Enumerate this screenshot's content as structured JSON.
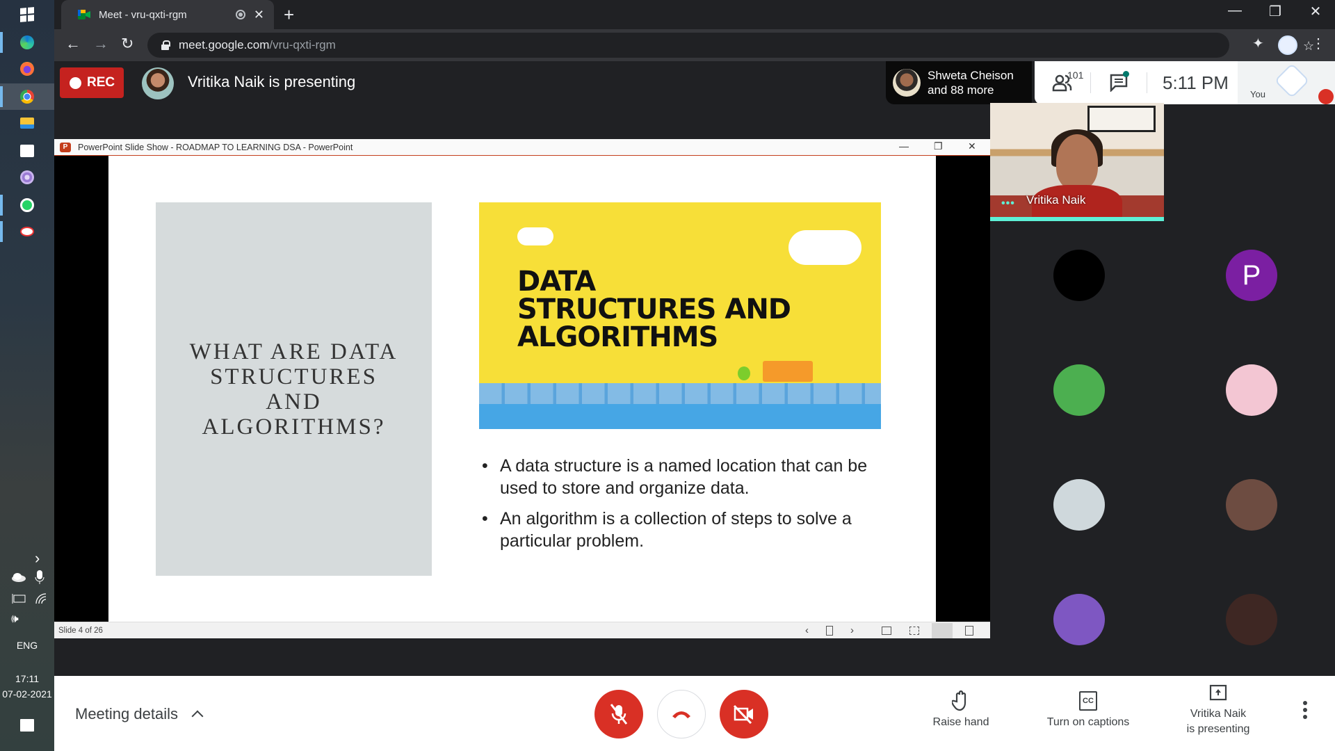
{
  "taskbar": {
    "apps": [
      {
        "name": "windows-start",
        "active": false
      },
      {
        "name": "edge",
        "active": false,
        "running": true
      },
      {
        "name": "firefox",
        "active": false
      },
      {
        "name": "chrome",
        "active": true,
        "running": true
      },
      {
        "name": "file-explorer",
        "active": false
      },
      {
        "name": "microsoft-store",
        "active": false
      },
      {
        "name": "tor-browser",
        "active": false
      },
      {
        "name": "whatsapp",
        "active": false,
        "running": true
      },
      {
        "name": "snipping-tool",
        "active": false,
        "running": true
      }
    ],
    "tray": {
      "language": "ENG",
      "time": "17:11",
      "date": "07-02-2021",
      "expand_glyph": "›",
      "volume_glyph": "🕪"
    }
  },
  "browser": {
    "tab_title": "Meet - vru-qxti-rgm",
    "new_tab_glyph": "+",
    "close_glyph": "✕",
    "url_host": "meet.google.com",
    "url_path": "/vru-qxti-rgm",
    "window_controls": {
      "minimize": "—",
      "maximize": "❐",
      "close": "✕"
    },
    "nav": {
      "back": "←",
      "forward": "→",
      "reload": "↻"
    },
    "toolbar_icons": {
      "camera": "■",
      "star": "☆",
      "extensions": "✦",
      "menu": "⋮"
    }
  },
  "meet": {
    "rec_label": "REC",
    "presenting_banner": "Vritika Naik is presenting",
    "who_is_here": {
      "line1": "Shweta Cheison",
      "line2": "and 88 more"
    },
    "participant_count": "101",
    "clock": "5:11  PM",
    "self_label": "You",
    "featured": {
      "name": "Vritika Naik",
      "dots": "•••"
    },
    "tiles": [
      {
        "initial": "",
        "color": "#000000"
      },
      {
        "initial": "P",
        "color": "#7b1fa2"
      },
      {
        "initial": "",
        "color": "#4caf50"
      },
      {
        "initial": "",
        "color": "#f3c6d3"
      },
      {
        "initial": "",
        "color": "#cfd8dc"
      },
      {
        "initial": "",
        "color": "#6d4c41"
      },
      {
        "initial": "",
        "color": "#7e57c2"
      },
      {
        "initial": "",
        "color": "#3e2723"
      }
    ],
    "accent_teal": "#5ef0d6",
    "danger_red": "#d93025"
  },
  "powerpoint": {
    "window_title": "PowerPoint Slide Show  -  ROADMAP TO LEARNING DSA - PowerPoint",
    "logo_letter": "P",
    "window_controls": {
      "minimize": "—",
      "restore": "❐",
      "close": "✕"
    },
    "slide_counter": "Slide 4 of 26",
    "status_nav": {
      "prev": "‹",
      "next": "›"
    },
    "slide": {
      "left_heading": "WHAT ARE DATA STRUCTURES AND ALGORITHMS?",
      "image_title_lines": [
        "DATA",
        "STRUCTURES AND",
        "ALGORITHMS"
      ],
      "bullets": [
        "A data structure is a named location that can be used to store and organize data.",
        "An algorithm is a collection of steps to solve a particular problem."
      ]
    }
  },
  "bottom_bar": {
    "meeting_details": "Meeting details",
    "raise_hand": "Raise hand",
    "captions": "Turn on captions",
    "present_line1": "Vritika Naik",
    "present_line2": "is presenting",
    "cc_glyph": "CC"
  }
}
